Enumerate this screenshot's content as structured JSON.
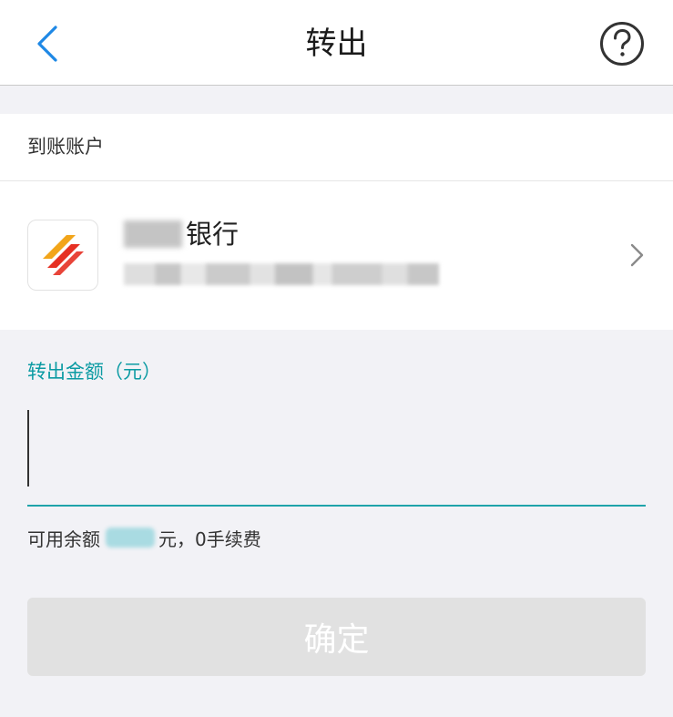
{
  "header": {
    "title": "转出",
    "back_icon": "back-chevron-icon",
    "help_icon": "question-circle-icon"
  },
  "account": {
    "section_label": "到账账户",
    "bank_name_visible": "银行",
    "bank_logo_icon": "bank-logo-icon",
    "arrow_icon": "chevron-right-icon"
  },
  "amount": {
    "label": "转出金额（元）",
    "value": "",
    "balance_prefix": "可用余额",
    "balance_suffix": "元，0手续费"
  },
  "actions": {
    "confirm_label": "确定"
  },
  "colors": {
    "accent": "#0c9ba3",
    "back_icon": "#1e88e5",
    "button_disabled_bg": "#e1e1e1",
    "page_bg": "#f2f2f6"
  }
}
